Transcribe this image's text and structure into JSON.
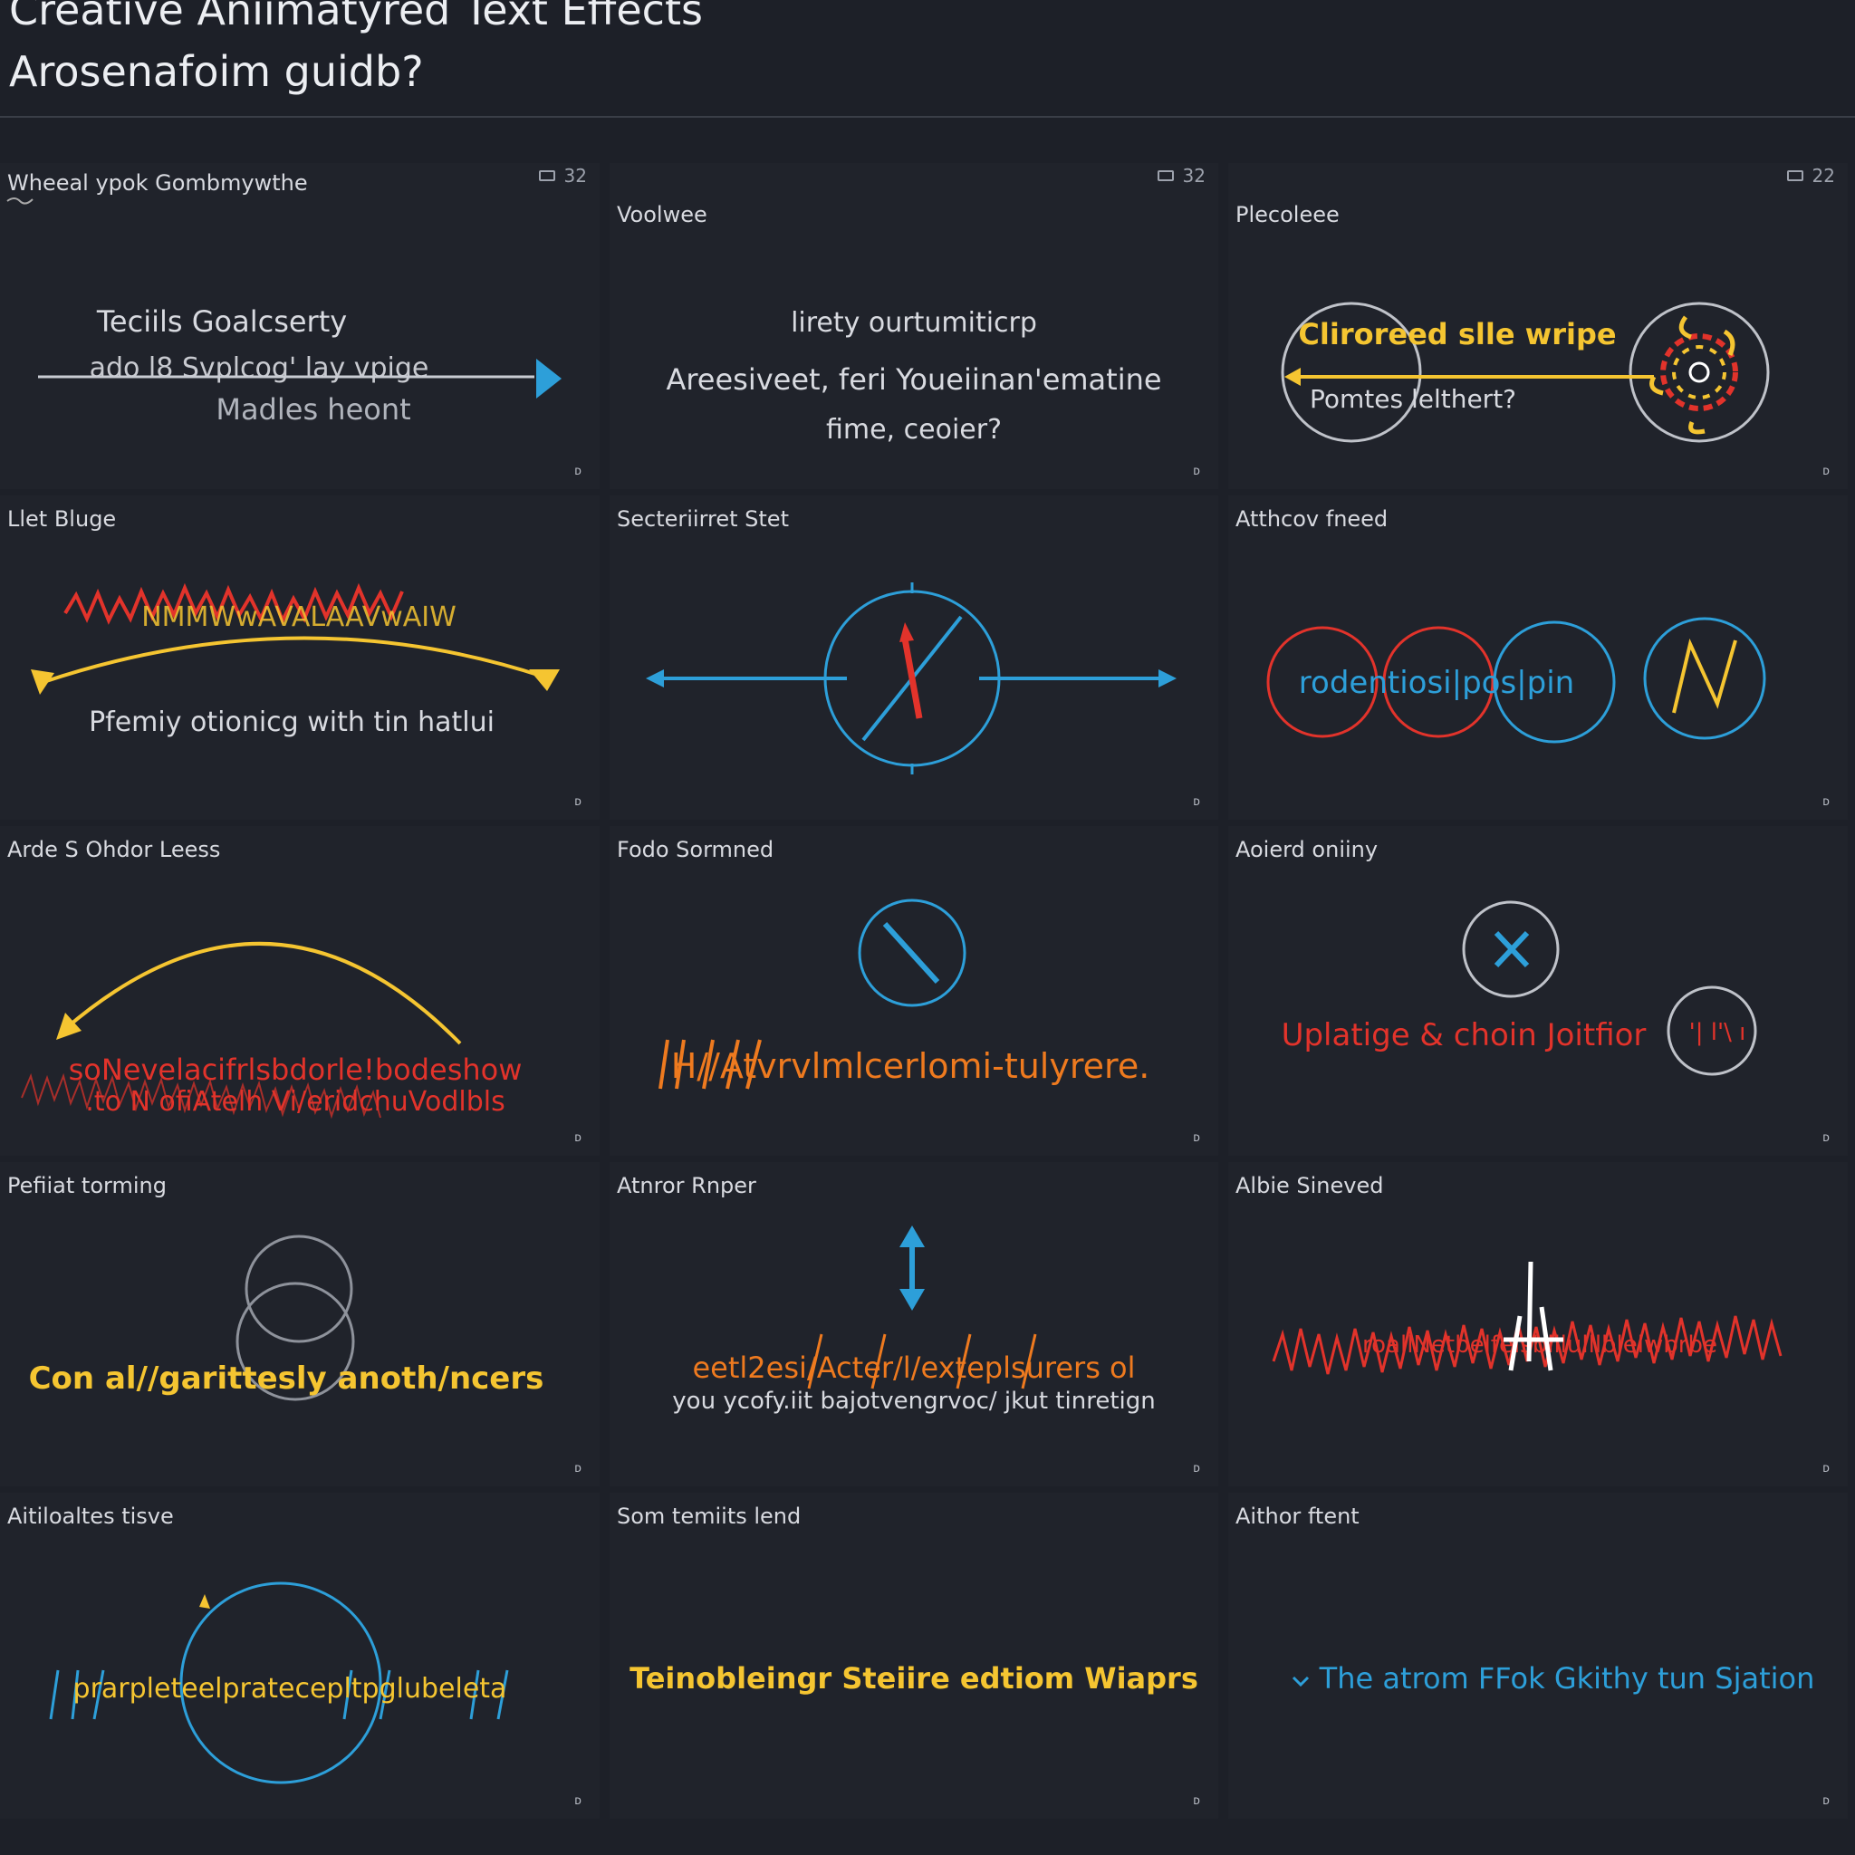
{
  "header": {
    "title_line1": "Creative Aniimatyred Text Effects",
    "title_line2": "Arosenafoim guidb?"
  },
  "colors": {
    "background": "#1d2028",
    "panel": "#20232b",
    "yellow": "#f5c531",
    "blue": "#2d9fd9",
    "red": "#e2332b",
    "orange": "#ee7a1f"
  },
  "panels": [
    {
      "title": "Wheeal ypok Gombmywthe",
      "meta": "32",
      "corner": "ᴅ",
      "texts": {
        "line1": "Teciils Goalcserty",
        "line2": "ado l8 Svplcog' lay vpige",
        "line3": "Madles heont"
      }
    },
    {
      "title": "Voolwee",
      "meta": "32",
      "corner": "ᴅ",
      "texts": {
        "line1": "lirety ourtumiticrp",
        "line2": "Areesiveet, feri Youeiinan'ematine",
        "line3": "fime, ceoier?"
      }
    },
    {
      "title": "Plecoleee",
      "meta": "22",
      "corner": "ᴅ",
      "texts": {
        "line1": "Cliroreed slle wripe",
        "line2": "Pomtes lelthert?"
      }
    },
    {
      "title": "Llet Bluge",
      "corner": "ᴅ",
      "texts": {
        "line1": "NMMWwAVALAAVwAIW",
        "line2": "Pfemiy otionicg with tin hatlui"
      }
    },
    {
      "title": "Secteriirret Stet",
      "corner": "ᴅ",
      "texts": {}
    },
    {
      "title": "Atthcov fneed",
      "corner": "ᴅ",
      "texts": {
        "line1": "rodentiosi|pos|pin"
      }
    },
    {
      "title": "Arde S Ohdor Leess",
      "corner": "ᴅ",
      "texts": {
        "line1": "soNevelacifrlsbdorle!bodeshow",
        "line2": ".to N ofiAtelh Vi/eridchuVodlbls"
      }
    },
    {
      "title": "Fodo Sormned",
      "corner": "ᴅ",
      "texts": {
        "line1": "H//Atvrvlmlcerlomi-tulyrere."
      }
    },
    {
      "title": "Aoierd oniiny",
      "corner": "ᴅ",
      "texts": {
        "line1": "Uplatige & choin Joitfior",
        "line2": "'| l'\\ ı"
      }
    },
    {
      "title": "Pefiiat torming",
      "corner": "ᴅ",
      "texts": {
        "line1": "Con al//garittesly anoth/ncers"
      }
    },
    {
      "title": "Atnror Rnper",
      "corner": "ᴅ",
      "texts": {
        "line1": "eetl2esi/Acter/l/exteplsurers ol",
        "line2": "you ycofy.iit  bajotvengrvoc/ jkut tinretign"
      }
    },
    {
      "title": "Albie Sineved",
      "corner": "ᴅ",
      "texts": {
        "line1": "roallNetbelfelsblllulllblelwbrbe"
      }
    },
    {
      "title": "Aitiloaltes tisve",
      "corner": "ᴅ",
      "texts": {
        "line1": "prarpleteelpratecepltpglubeleta"
      }
    },
    {
      "title": "Som temiits lend",
      "corner": "ᴅ",
      "texts": {
        "line1": "Teinobleingr Steiire edtiom Wiaprs"
      }
    },
    {
      "title": "Aithor ftent",
      "corner": "ᴅ",
      "texts": {
        "line1": "The atrom FFok Gkithy tun Sjation"
      }
    }
  ]
}
